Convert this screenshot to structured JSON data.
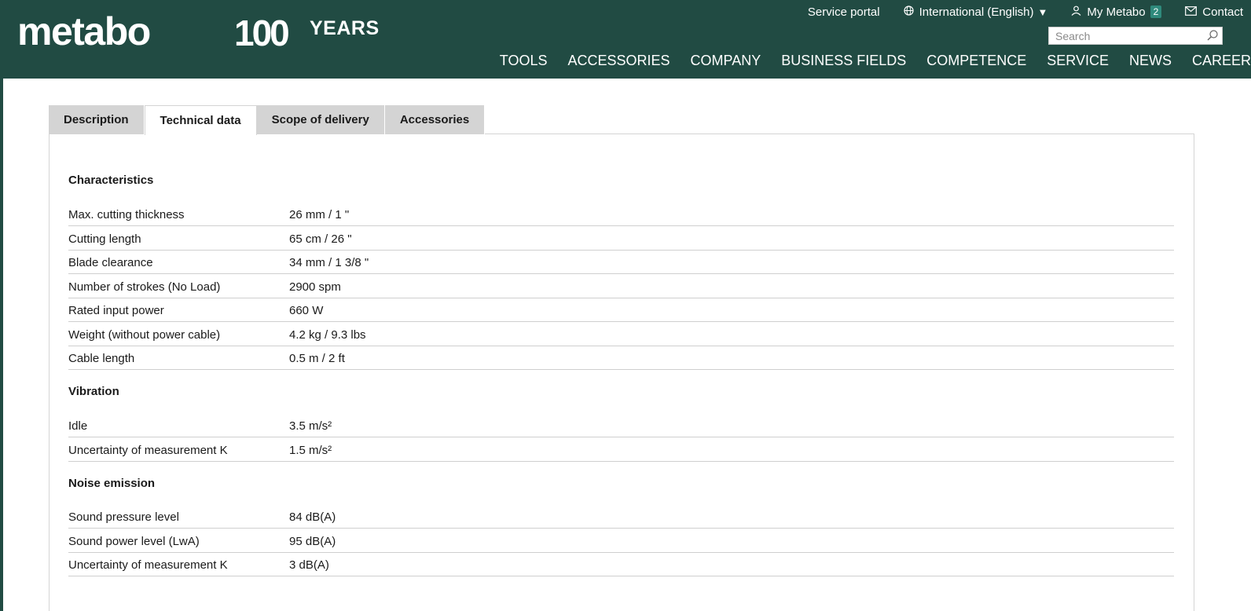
{
  "header": {
    "logo": "metabo",
    "logo_100": "100",
    "logo_years": "YEARS",
    "top_links": {
      "service_portal": "Service portal",
      "language": "International (English)",
      "my_metabo": "My Metabo",
      "my_metabo_count": "2",
      "contact": "Contact"
    },
    "search_placeholder": "Search",
    "nav": [
      "TOOLS",
      "ACCESSORIES",
      "COMPANY",
      "BUSINESS FIELDS",
      "COMPETENCE",
      "SERVICE",
      "NEWS",
      "CAREER"
    ]
  },
  "tabs": [
    {
      "label": "Description",
      "active": false
    },
    {
      "label": "Technical data",
      "active": true
    },
    {
      "label": "Scope of delivery",
      "active": false
    },
    {
      "label": "Accessories",
      "active": false
    }
  ],
  "sections": [
    {
      "title": "Characteristics",
      "rows": [
        {
          "label": "Max. cutting thickness",
          "value": "26 mm / 1 \""
        },
        {
          "label": "Cutting length",
          "value": "65 cm / 26 \""
        },
        {
          "label": "Blade clearance",
          "value": "34 mm / 1 3/8 \""
        },
        {
          "label": "Number of strokes (No Load)",
          "value": "2900 spm"
        },
        {
          "label": "Rated input power",
          "value": "660 W"
        },
        {
          "label": "Weight (without power cable)",
          "value": "4.2 kg / 9.3 lbs"
        },
        {
          "label": "Cable length",
          "value": "0.5 m / 2 ft"
        }
      ]
    },
    {
      "title": "Vibration",
      "rows": [
        {
          "label": "Idle",
          "value": "3.5 m/s²"
        },
        {
          "label": "Uncertainty of measurement K",
          "value": "1.5 m/s²"
        }
      ]
    },
    {
      "title": "Noise emission",
      "rows": [
        {
          "label": "Sound pressure level",
          "value": "84 dB(A)"
        },
        {
          "label": "Sound power level (LwA)",
          "value": "95 dB(A)"
        },
        {
          "label": "Uncertainty of measurement K",
          "value": "3 dB(A)"
        }
      ]
    }
  ],
  "colors": {
    "header_bg": "#214b43",
    "tab_inactive_bg": "#d4d4d4",
    "badge_bg": "#2f8a7c"
  },
  "icons": {
    "language": "globe-icon",
    "account": "user-icon",
    "contact": "envelope-icon",
    "search": "search-icon",
    "dropdown": "caret-down-icon"
  }
}
